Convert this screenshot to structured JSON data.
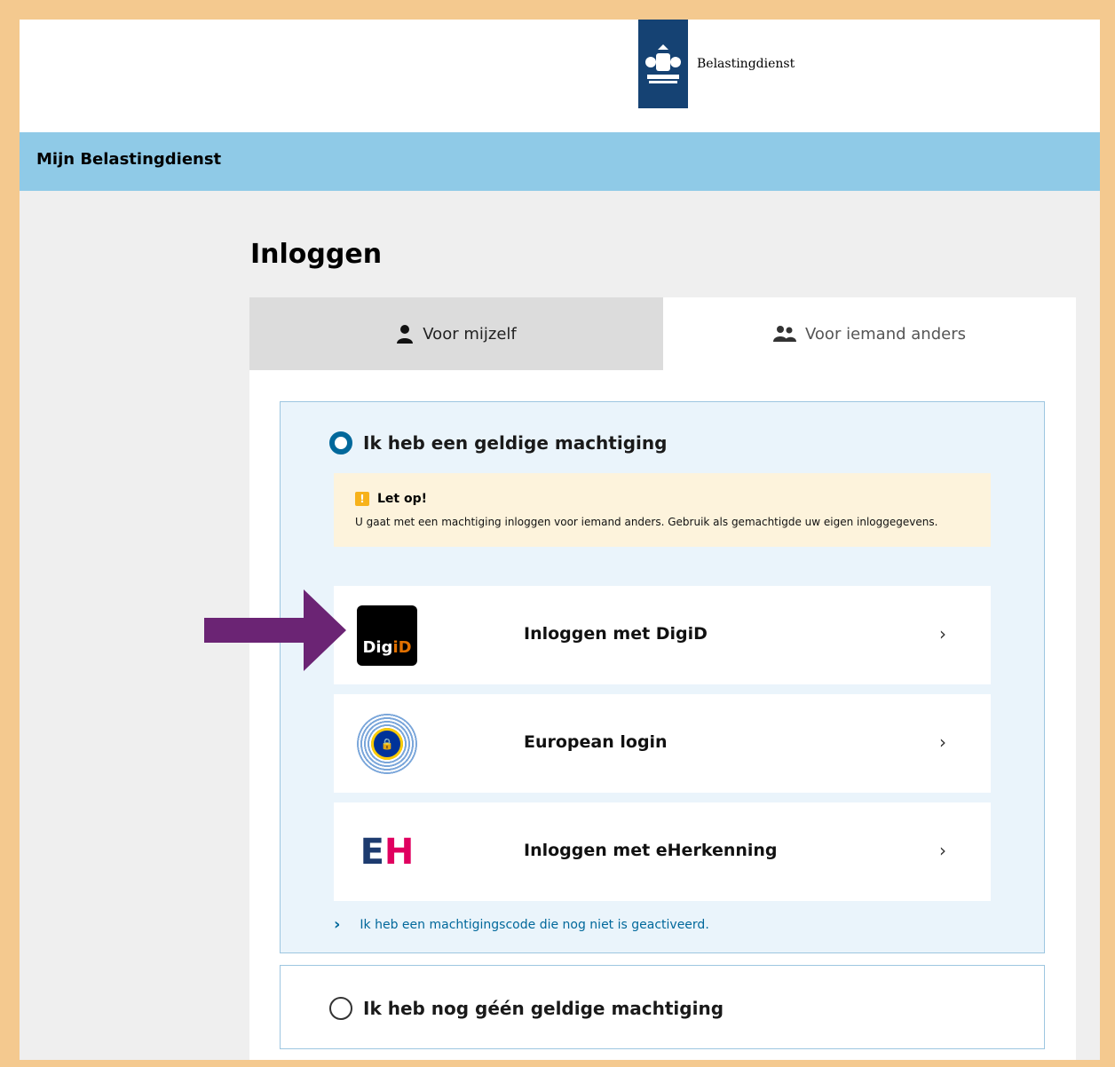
{
  "header": {
    "org_name": "Belastingdienst",
    "bar_title": "Mijn Belastingdienst"
  },
  "page": {
    "title": "Inloggen"
  },
  "tabs": [
    {
      "label": "Voor mijzelf",
      "icon": "user-icon",
      "active": true
    },
    {
      "label": "Voor iemand anders",
      "icon": "users-icon",
      "active": false
    }
  ],
  "authorization": {
    "valid_option_label": "Ik heb een geldige machtiging",
    "valid_option_checked": true,
    "notice": {
      "title": "Let op!",
      "text": "U gaat met een machtiging inloggen voor iemand anders. Gebruik als gemachtigde uw eigen inloggegevens."
    },
    "login_methods": [
      {
        "label": "Inloggen met DigiD",
        "icon": "digid-logo",
        "logo_text_1": "Dig",
        "logo_text_2": "iD"
      },
      {
        "label": "European login",
        "icon": "eu-login-logo"
      },
      {
        "label": "Inloggen met eHerkenning",
        "icon": "eherkenning-logo",
        "logo_text_1": "E",
        "logo_text_2": "H"
      }
    ],
    "code_link": "Ik heb een machtigingscode die nog niet is geactiveerd.",
    "no_valid_option_label": "Ik heb nog géén geldige machtiging",
    "no_valid_option_checked": false
  },
  "colors": {
    "brand_blue": "#154273",
    "bar_blue": "#8fcae7",
    "link_blue": "#01689b",
    "arrow_purple": "#6b2474",
    "frame_orange": "#f4c98f"
  }
}
